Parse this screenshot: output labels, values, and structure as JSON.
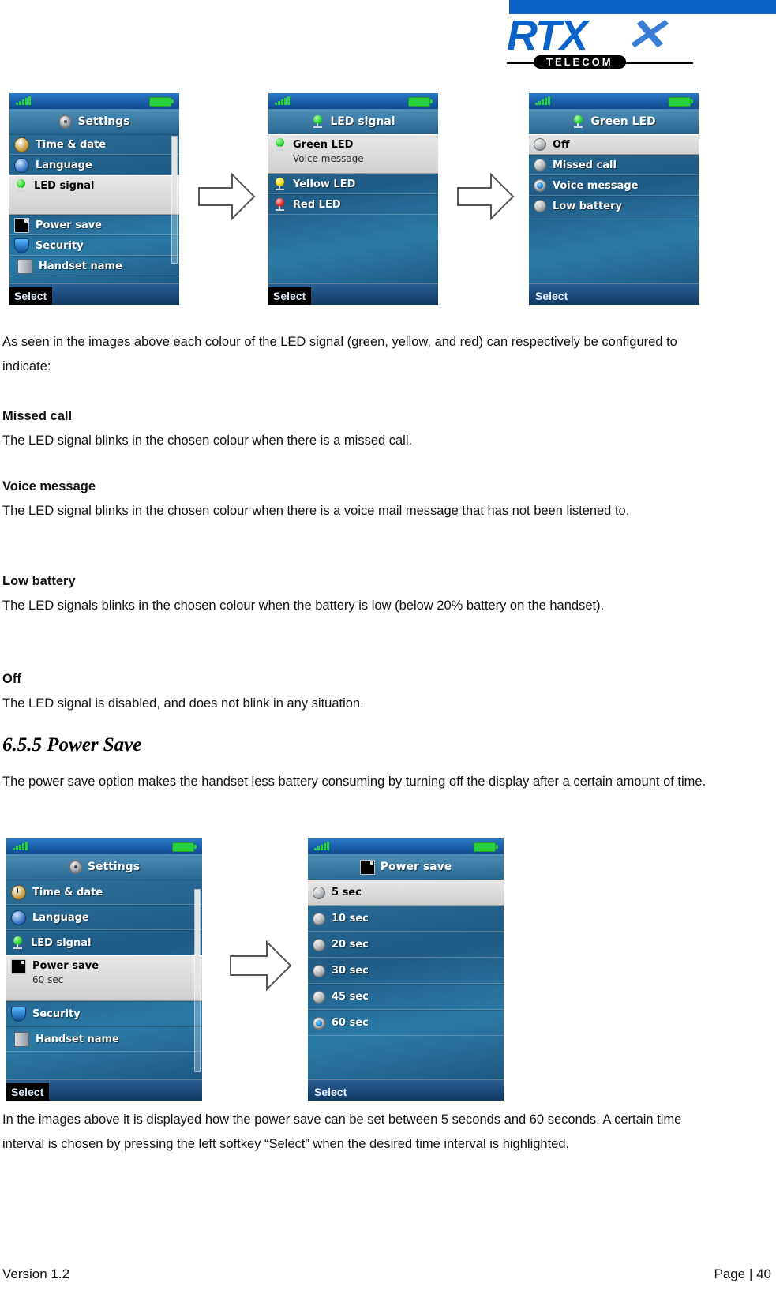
{
  "header": {
    "logo_main": "RTX",
    "logo_sub": "TELECOM",
    "bar_color": "#0b62c8"
  },
  "screens": {
    "settings_led": {
      "title": "Settings",
      "title_icon": "gear-icon",
      "softkey": "Select",
      "items": [
        {
          "label": "Time & date",
          "icon": "clock-icon",
          "selected": false
        },
        {
          "label": "Language",
          "icon": "globe-icon",
          "selected": false
        },
        {
          "label": "LED signal",
          "icon": "green-led-icon",
          "selected": true
        },
        {
          "label": "Power save",
          "icon": "screen-icon",
          "selected": false
        },
        {
          "label": "Security",
          "icon": "shield-icon",
          "selected": false
        },
        {
          "label": "Handset name",
          "icon": "handset-icon",
          "selected": false
        }
      ]
    },
    "led_signal": {
      "title": "LED signal",
      "title_icon": "green-led-icon",
      "softkey": "Select",
      "items": [
        {
          "label": "Green LED",
          "sub": "Voice message",
          "icon": "green-led-icon",
          "selected": true
        },
        {
          "label": "Yellow LED",
          "sub": "",
          "icon": "yellow-led-icon",
          "selected": false
        },
        {
          "label": "Red LED",
          "sub": "",
          "icon": "red-led-icon",
          "selected": false
        }
      ]
    },
    "green_led": {
      "title": "Green LED",
      "title_icon": "green-led-icon",
      "softkey": "Select",
      "options": [
        {
          "label": "Off",
          "checked": false,
          "highlighted": true
        },
        {
          "label": "Missed call",
          "checked": false,
          "highlighted": false
        },
        {
          "label": "Voice message",
          "checked": true,
          "highlighted": false
        },
        {
          "label": "Low battery",
          "checked": false,
          "highlighted": false
        }
      ]
    },
    "settings_power": {
      "title": "Settings",
      "title_icon": "gear-icon",
      "softkey": "Select",
      "items": [
        {
          "label": "Time & date",
          "icon": "clock-icon",
          "selected": false
        },
        {
          "label": "Language",
          "icon": "globe-icon",
          "selected": false
        },
        {
          "label": "LED signal",
          "icon": "green-led-icon",
          "selected": false
        },
        {
          "label": "Power save",
          "sub": "60 sec",
          "icon": "screen-icon",
          "selected": true
        },
        {
          "label": "Security",
          "icon": "shield-icon",
          "selected": false
        },
        {
          "label": "Handset name",
          "icon": "handset-icon",
          "selected": false
        }
      ]
    },
    "power_save": {
      "title": "Power save",
      "title_icon": "screen-icon",
      "softkey": "Select",
      "options": [
        {
          "label": "5 sec",
          "checked": false,
          "highlighted": true
        },
        {
          "label": "10 sec",
          "checked": false,
          "highlighted": false
        },
        {
          "label": "20 sec",
          "checked": false,
          "highlighted": false
        },
        {
          "label": "30 sec",
          "checked": false,
          "highlighted": false
        },
        {
          "label": "45 sec",
          "checked": false,
          "highlighted": false
        },
        {
          "label": "60 sec",
          "checked": true,
          "highlighted": false
        }
      ]
    }
  },
  "body": {
    "intro": "As seen in the images above each colour of the LED signal (green, yellow, and red) can respectively be configured to indicate:",
    "missed_call_head": "Missed call",
    "missed_call_text": "The LED signal blinks in the chosen colour when there is a missed call.",
    "voice_message_head": "Voice message",
    "voice_message_text": "The LED signal blinks in the chosen colour when there is a voice mail message that has not been listened to.",
    "low_battery_head": "Low battery",
    "low_battery_text": "The LED signals blinks in the chosen colour when the battery is low (below 20% battery on the handset).",
    "off_head": "Off",
    "off_text": "The LED signal is disabled, and does not blink in any situation.",
    "section_heading": "6.5.5 Power Save",
    "power_save_text": "The power save option makes the handset less battery consuming by turning off the display after a certain amount of time.",
    "power_save_closing": "In the images above it is displayed how the power save can be set between 5 seconds and 60 seconds. A certain time interval is chosen by pressing the left softkey “Select” when the desired time interval is highlighted."
  },
  "footer": {
    "version": "Version 1.2",
    "page": "Page | 40"
  }
}
